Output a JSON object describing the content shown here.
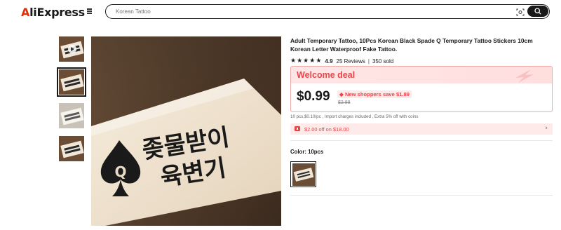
{
  "header": {
    "logo_text": "AliExpress",
    "menu_icon": "hamburger-menu-icon",
    "search": {
      "value": "",
      "placeholder": "Korean Tattoo",
      "camera_icon": "camera-search-icon",
      "search_icon": "search-icon"
    }
  },
  "gallery": {
    "thumbnails": [
      {
        "name": "thumbnail-video",
        "has_play": true,
        "selected": false
      },
      {
        "name": "thumbnail-1",
        "has_play": false,
        "selected": true
      },
      {
        "name": "thumbnail-2",
        "has_play": false,
        "selected": false
      },
      {
        "name": "thumbnail-3",
        "has_play": false,
        "selected": false
      }
    ],
    "main_image_text_line1": "좆물받이",
    "main_image_text_line2": "육변기",
    "main_image_symbol": "Q"
  },
  "product": {
    "title": "Adult Temporary Tattoo, 10Pcs Korean Black Spade Q Temporary Tattoo Stickers 10cm Korean Letter Waterproof Fake Tattoo.",
    "rating": "4.9",
    "stars": 5,
    "reviews": "25 Reviews",
    "sold": "350 sold",
    "deal": {
      "title": "Welcome deal",
      "price": "$0.99",
      "new_shopper_save": "New shoppers save $1.89",
      "old_price": "$2.88"
    },
    "fine_print": "10 pcs,$0.10/pc , Import charges included , Extra 5% off with coins",
    "coupon": {
      "text": "$2.00 off on $18.00",
      "icon": "coupon-icon",
      "arrow_icon": "chevron-right-icon"
    },
    "color": {
      "label": "Color:",
      "value": "10pcs"
    }
  },
  "colors": {
    "accent": "#e8454a",
    "deal_bg": "#ffe6e6",
    "text": "#191919"
  }
}
